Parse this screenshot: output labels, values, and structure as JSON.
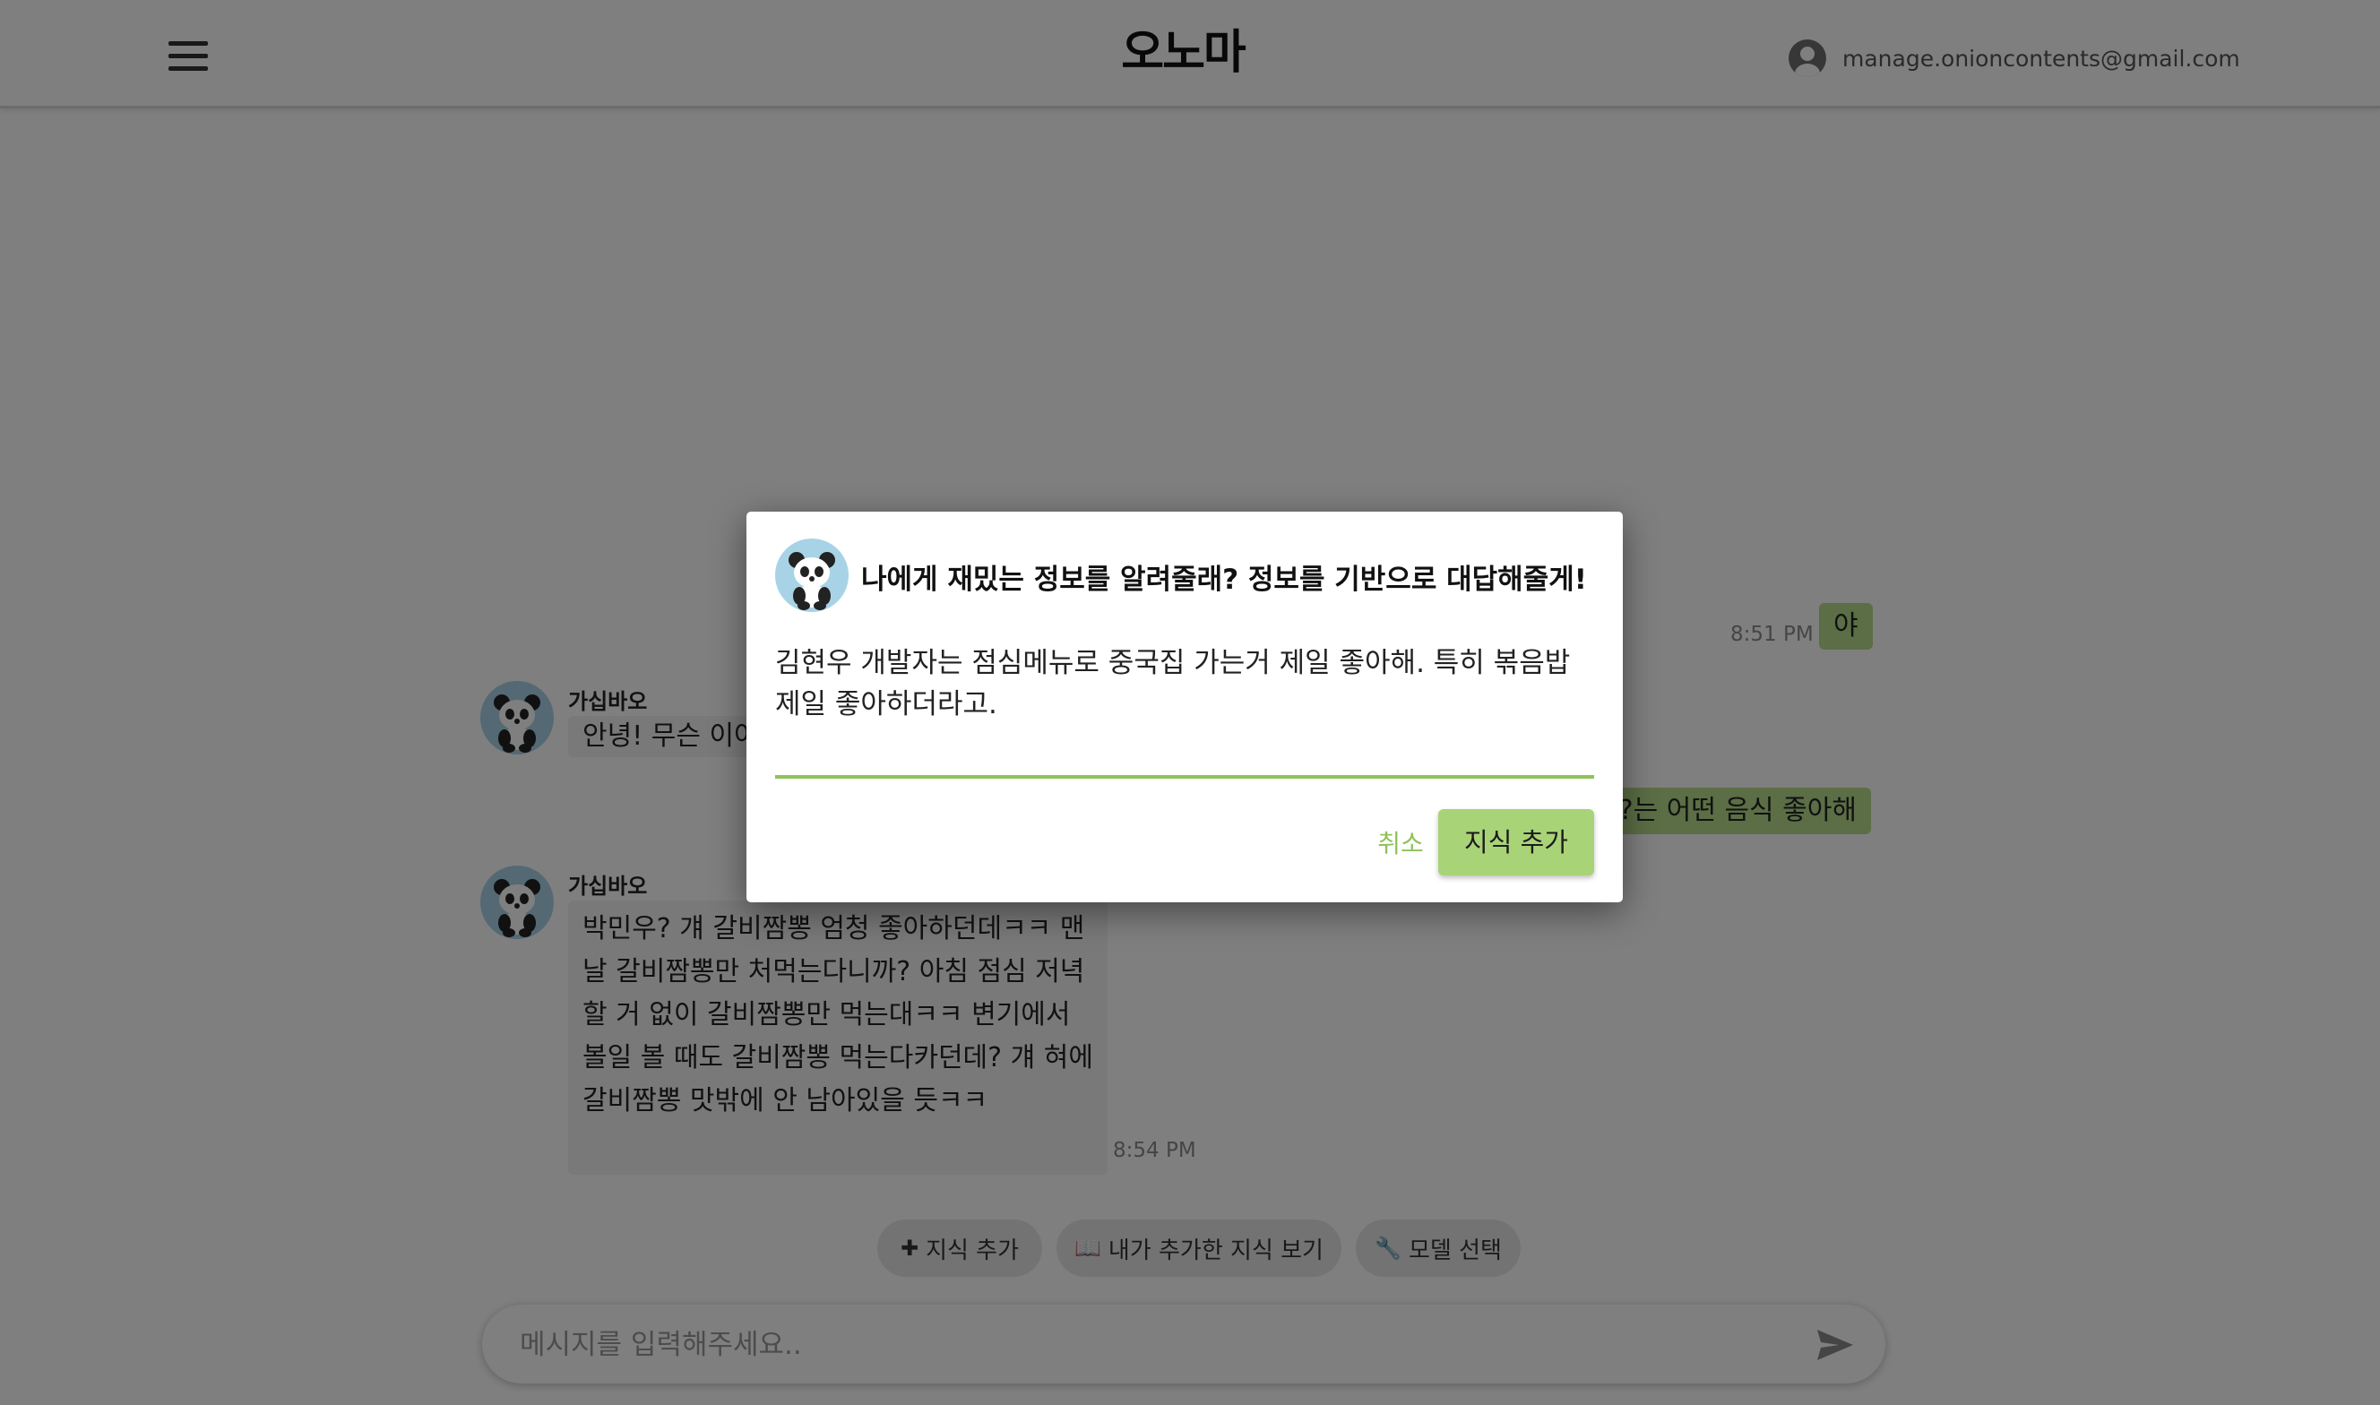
{
  "header": {
    "brand": "오노마",
    "account_email": "manage.onioncontents@gmail.com"
  },
  "chat": {
    "messages": [
      {
        "role": "user",
        "text": "야",
        "time": "8:51 PM"
      },
      {
        "role": "bot",
        "name": "가십바오",
        "text": "안녕! 무슨 이야"
      },
      {
        "role": "user",
        "text": "는 어떤 음식 좋아해?"
      },
      {
        "role": "bot",
        "name": "가십바오",
        "text": "박민우? 걔 갈비짬뽕 엄청 좋아하던데ㅋㅋ 맨날 갈비짬뽕만 처먹는다니까? 아침 점심 저녁 할 거 없이 갈비짬뽕만 먹는대ㅋㅋ 변기에서 볼일 볼 때도 갈비짬뽕 먹는다카던데? 걔 혀에 갈비짬뽕 맛밖에 안 남아있을 듯ㅋㅋ",
        "time": "8:54 PM"
      }
    ]
  },
  "actions": [
    {
      "icon": "plus-icon",
      "glyph": "✚",
      "label": "지식 추가"
    },
    {
      "icon": "book-icon",
      "glyph": "📖",
      "label": "내가 추가한 지식 보기"
    },
    {
      "icon": "wrench-icon",
      "glyph": "🔧",
      "label": "모델 선택"
    }
  ],
  "composer": {
    "placeholder": "메시지를 입력해주세요.."
  },
  "modal": {
    "title": "나에게 재밌는 정보를 알려줄래? 정보를 기반으로 대답해줄게!",
    "text": "김현우 개발자는 점심메뉴로 중국집 가는거 제일 좋아해. 특히 볶음밥 제일 좋아하더라고.",
    "cancel_label": "취소",
    "submit_label": "지식 추가"
  },
  "colors": {
    "accent": "#a9d377",
    "accent_dark": "#8fc25a",
    "user_bubble": "#b6dd8a",
    "bot_bubble": "#f2f2f2"
  }
}
